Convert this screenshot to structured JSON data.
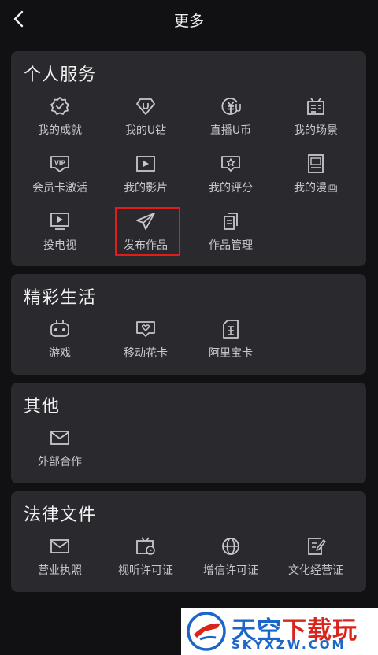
{
  "header": {
    "title": "更多",
    "back_icon": "chevron-left-icon"
  },
  "sections": [
    {
      "title": "个人服务",
      "items": [
        {
          "label": "我的成就",
          "icon": "badge-icon"
        },
        {
          "label": "我的U钻",
          "icon": "diamond-icon"
        },
        {
          "label": "直播U币",
          "icon": "coin-icon"
        },
        {
          "label": "我的场景",
          "icon": "calendar-icon"
        },
        {
          "label": "会员卡激活",
          "icon": "vip-card-icon"
        },
        {
          "label": "我的影片",
          "icon": "video-icon"
        },
        {
          "label": "我的评分",
          "icon": "star-rating-icon"
        },
        {
          "label": "我的漫画",
          "icon": "comic-book-icon"
        },
        {
          "label": "投电视",
          "icon": "cast-tv-icon"
        },
        {
          "label": "发布作品",
          "icon": "paper-plane-icon"
        },
        {
          "label": "作品管理",
          "icon": "files-icon"
        }
      ]
    },
    {
      "title": "精彩生活",
      "items": [
        {
          "label": "游戏",
          "icon": "gamepad-icon"
        },
        {
          "label": "移动花卡",
          "icon": "heart-card-icon"
        },
        {
          "label": "阿里宝卡",
          "icon": "sim-card-icon"
        }
      ]
    },
    {
      "title": "其他",
      "items": [
        {
          "label": "外部合作",
          "icon": "mail-icon"
        }
      ]
    },
    {
      "title": "法律文件",
      "items": [
        {
          "label": "营业执照",
          "icon": "mail-icon"
        },
        {
          "label": "视听许可证",
          "icon": "tv-icon"
        },
        {
          "label": "增信许可证",
          "icon": "globe-icon"
        },
        {
          "label": "文化经营证",
          "icon": "document-edit-icon"
        }
      ]
    }
  ],
  "watermark": {
    "brand_a": "天空",
    "brand_b": "下载玩",
    "url": "SKYXZW.COM"
  },
  "colors": {
    "background": "#111113",
    "card": "#2a2a2e",
    "highlight": "#e21b1b",
    "watermark_blue": "#1b66c9",
    "watermark_red": "#d9251d"
  }
}
